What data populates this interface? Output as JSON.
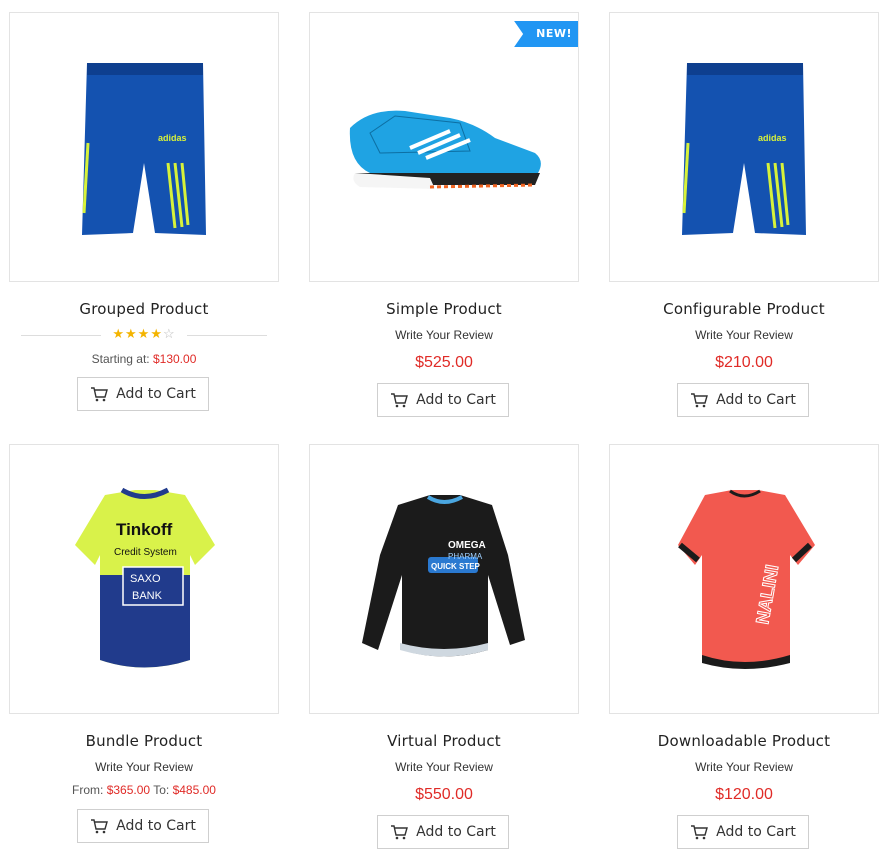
{
  "products": [
    {
      "name": "Grouped Product",
      "rating": 4,
      "rating_max": 5,
      "price_prefix": "Starting at:",
      "price": "$130.00",
      "cart_label": "Add to Cart",
      "image": "blue-shorts"
    },
    {
      "name": "Simple Product",
      "review": "Write Your Review",
      "price": "$525.00",
      "cart_label": "Add to Cart",
      "badge": "NEW!",
      "image": "blue-shoe"
    },
    {
      "name": "Configurable Product",
      "review": "Write Your Review",
      "price": "$210.00",
      "cart_label": "Add to Cart",
      "image": "blue-shorts"
    },
    {
      "name": "Bundle Product",
      "review": "Write Your Review",
      "price_from_label": "From:",
      "price_from": "$365.00",
      "price_to_label": "To:",
      "price_to": "$485.00",
      "cart_label": "Add to Cart",
      "image": "yellow-jersey"
    },
    {
      "name": "Virtual Product",
      "review": "Write Your Review",
      "price": "$550.00",
      "cart_label": "Add to Cart",
      "image": "black-jersey"
    },
    {
      "name": "Downloadable Product",
      "review": "Write Your Review",
      "price": "$120.00",
      "cart_label": "Add to Cart",
      "image": "red-jersey"
    }
  ],
  "jersey_text": {
    "yellow_1": "Tinkoff",
    "yellow_2": "Credit System",
    "yellow_3": "SAXO",
    "yellow_4": "BANK",
    "black_1": "OMEGA",
    "black_2": "PHARMA",
    "black_3": "QUICK STEP",
    "red_1": "NALINI"
  },
  "colors": {
    "price_red": "#e02b27",
    "badge_blue": "#2196f3",
    "star_gold": "#f4b400"
  }
}
